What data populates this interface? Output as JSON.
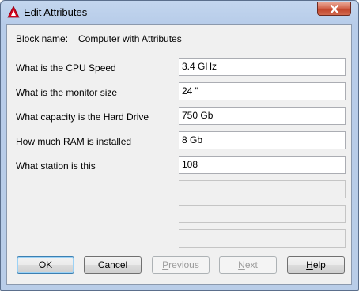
{
  "window": {
    "title": "Edit Attributes"
  },
  "block": {
    "label": "Block name:",
    "value": "Computer with Attributes"
  },
  "attributes": [
    {
      "prompt": "What is the CPU Speed",
      "value": "3.4 GHz"
    },
    {
      "prompt": "What is the monitor size",
      "value": "24 \""
    },
    {
      "prompt": "What capacity is the Hard Drive",
      "value": "750 Gb"
    },
    {
      "prompt": "How much RAM is installed",
      "value": "8 Gb"
    },
    {
      "prompt": "What station is this",
      "value": "108"
    }
  ],
  "empty_fields": 3,
  "buttons": {
    "ok": "OK",
    "cancel": "Cancel",
    "previous_u": "P",
    "previous_rest": "revious",
    "next_u": "N",
    "next_rest": "ext",
    "help_u": "H",
    "help_rest": "elp"
  },
  "colors": {
    "accent": "#3c7fb1",
    "close": "#c2452c",
    "app_icon": "#d0021b"
  },
  "icons": {
    "app": "autocad-icon",
    "close": "close-icon"
  }
}
